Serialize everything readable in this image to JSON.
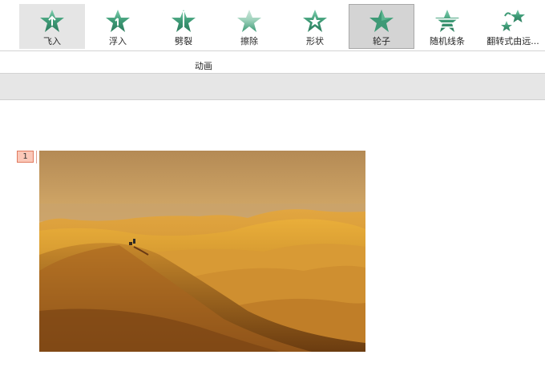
{
  "ribbon": {
    "effects": [
      {
        "label": "飞入",
        "icon": "fly-in-star-icon",
        "state": "hover"
      },
      {
        "label": "浮入",
        "icon": "float-in-star-icon",
        "state": "normal"
      },
      {
        "label": "劈裂",
        "icon": "split-star-icon",
        "state": "normal"
      },
      {
        "label": "擦除",
        "icon": "wipe-star-icon",
        "state": "normal"
      },
      {
        "label": "形状",
        "icon": "shape-star-icon",
        "state": "normal"
      },
      {
        "label": "轮子",
        "icon": "wheel-star-icon",
        "state": "selected"
      },
      {
        "label": "随机线条",
        "icon": "random-bars-star-icon",
        "state": "normal"
      },
      {
        "label": "翻转式由远...",
        "icon": "grow-turn-star-icon",
        "state": "normal"
      }
    ],
    "group_label": "动画"
  },
  "slide": {
    "animation_tag": "1",
    "image": {
      "icon": "desert-dunes-photo"
    }
  },
  "colors": {
    "icon_green": "#3e9a76",
    "selected_bg": "#d4d4d4",
    "hover_bg": "#e5e5e5",
    "tag_bg": "#fbc8b8",
    "tag_border": "#e07a60"
  }
}
